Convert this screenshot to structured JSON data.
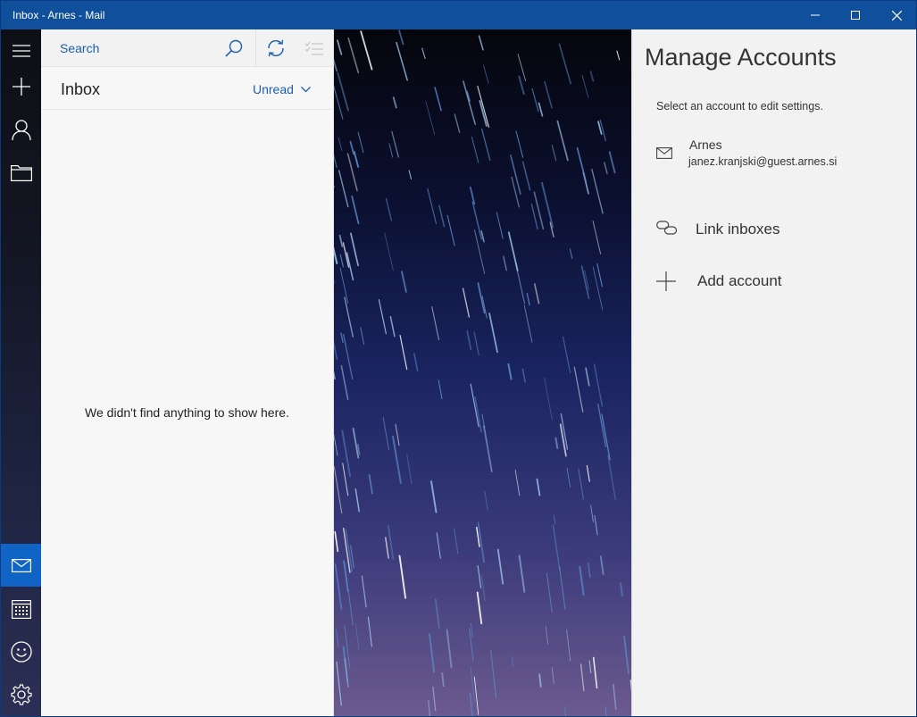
{
  "window": {
    "title": "Inbox - Arnes - Mail"
  },
  "titlebar_controls": [
    "minimize-icon",
    "maximize-icon",
    "close-icon"
  ],
  "rail": {
    "top_items": [
      "hamburger-menu-icon",
      "new-mail-icon",
      "accounts-icon",
      "folders-icon"
    ],
    "bottom_items": [
      "mail-icon",
      "calendar-icon",
      "feedback-smiley-icon",
      "settings-gear-icon"
    ],
    "active_item": "mail-icon",
    "accent_color": "#1064c5"
  },
  "search": {
    "placeholder": "Search",
    "icons": [
      "search-icon",
      "sync-icon",
      "select-mode-icon"
    ]
  },
  "list": {
    "folder_title": "Inbox",
    "filter_label": "Unread",
    "empty_message": "We didn't find anything to show here."
  },
  "manage_accounts": {
    "title": "Manage Accounts",
    "subtitle": "Select an account to edit settings.",
    "accounts": [
      {
        "name": "Arnes",
        "email": "janez.kranjski@guest.arnes.si",
        "icon": "mail-envelope-icon"
      }
    ],
    "actions": [
      {
        "label": "Link inboxes",
        "icon": "link-icon"
      },
      {
        "label": "Add account",
        "icon": "plus-icon"
      }
    ]
  },
  "colors": {
    "titlebar": "#0f4f9c",
    "link_blue": "#1a5fb4"
  }
}
